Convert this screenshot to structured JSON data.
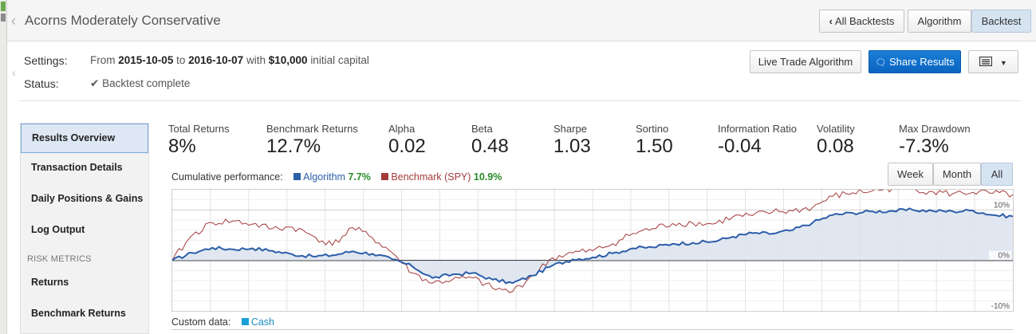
{
  "window": {
    "title": "Acorns Moderately Conservative"
  },
  "header": {
    "tabs": [
      {
        "label": "All Backtests"
      },
      {
        "label": "Algorithm"
      },
      {
        "label": "Backtest",
        "active": true
      }
    ]
  },
  "settings": {
    "settings_label": "Settings:",
    "from_word": "From",
    "start_date": "2015-10-05",
    "to_word": "to",
    "end_date": "2016-10-07",
    "with_word": "with",
    "capital": "$10,000",
    "capital_suffix": "initial capital",
    "status_label": "Status:",
    "status_check": "✔",
    "status_value": "Backtest complete"
  },
  "actions": {
    "live_trade": "Live Trade Algorithm",
    "share": "Share Results",
    "menu_icon": "list-icon"
  },
  "sidebar": {
    "items": [
      {
        "label": "Results Overview",
        "active": true
      },
      {
        "label": "Transaction Details"
      },
      {
        "label": "Daily Positions & Gains"
      },
      {
        "label": "Log Output"
      }
    ],
    "section": "RISK METRICS",
    "risk_items": [
      {
        "label": "Returns"
      },
      {
        "label": "Benchmark Returns"
      }
    ]
  },
  "metrics": [
    {
      "label": "Total Returns",
      "value": "8%"
    },
    {
      "label": "Benchmark Returns",
      "value": "12.7%"
    },
    {
      "label": "Alpha",
      "value": "0.02"
    },
    {
      "label": "Beta",
      "value": "0.48"
    },
    {
      "label": "Sharpe",
      "value": "1.03"
    },
    {
      "label": "Sortino",
      "value": "1.50"
    },
    {
      "label": "Information Ratio",
      "value": "-0.04"
    },
    {
      "label": "Volatility",
      "value": "0.08"
    },
    {
      "label": "Max Drawdown",
      "value": "-7.3%"
    }
  ],
  "performance": {
    "label": "Cumulative performance:",
    "algo_name": "Algorithm",
    "algo_value": "7.7%",
    "bench_name": "Benchmark (SPY)",
    "bench_value": "10.9%",
    "ranges": [
      "Week",
      "Month",
      "All"
    ],
    "active_range": "All"
  },
  "custom_data": {
    "label": "Custom data:",
    "series": "Cash"
  },
  "colors": {
    "algorithm": "#2c5ea8",
    "benchmark": "#a53a3a",
    "positive": "#2a8a2a",
    "cash": "#1aa0d8",
    "primary_button": "#0a64c0"
  },
  "chart_data": {
    "type": "line",
    "x_range": [
      "2015-10-05",
      "2016-10-07"
    ],
    "ylim": [
      -10,
      14
    ],
    "y_ticks": [
      {
        "value": 10,
        "label": "10%"
      },
      {
        "value": 0,
        "label": "0%"
      },
      {
        "value": -10,
        "label": "-10%"
      }
    ],
    "grid": true,
    "series": [
      {
        "name": "Algorithm",
        "values": [
          0,
          1.5,
          2.5,
          2.2,
          2.4,
          1.9,
          1.2,
          0.8,
          1.0,
          1.8,
          1.3,
          0.2,
          -1.2,
          -3.5,
          -2.8,
          -2.5,
          -3.8,
          -4.5,
          -3.0,
          -1.0,
          0.2,
          0.6,
          1.4,
          2.4,
          2.6,
          3.3,
          3.5,
          3.7,
          4.7,
          5.4,
          5.3,
          6.0,
          7.5,
          9.0,
          9.4,
          9.7,
          9.8,
          10.0,
          9.8,
          9.7,
          9.9,
          9.0,
          8.7
        ]
      },
      {
        "name": "Benchmark (SPY)",
        "values": [
          0,
          5.0,
          7.5,
          7.8,
          7.2,
          6.3,
          6.6,
          4.9,
          3.0,
          6.5,
          4.5,
          1.5,
          -2.5,
          -4.5,
          -3.8,
          -3.5,
          -5.5,
          -6.2,
          -3.0,
          0.5,
          1.5,
          1.9,
          3.3,
          5.3,
          6.3,
          7.3,
          7.4,
          7.2,
          8.6,
          8.9,
          9.6,
          9.8,
          10.5,
          12.7,
          13.4,
          13.8,
          14.3,
          14.2,
          13.6,
          13.2,
          13.5,
          13.3,
          13.0
        ]
      }
    ]
  }
}
